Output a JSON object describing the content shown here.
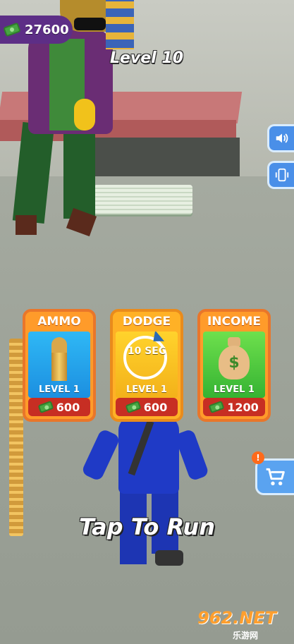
{
  "hud": {
    "money": "27600",
    "level_title": "Level 10"
  },
  "side_buttons": {
    "sound_icon": "speaker-icon",
    "vibration_icon": "vibration-icon"
  },
  "upgrades": [
    {
      "title": "AMMO",
      "level": "LEVEL 1",
      "price": "600",
      "icon": "bullet-icon",
      "color": "#2fb8f5"
    },
    {
      "title": "DODGE",
      "level": "LEVEL 1",
      "price": "600",
      "icon": "clock-icon",
      "timer_text": "10 SEC",
      "color": "#ffd32c"
    },
    {
      "title": "INCOME",
      "level": "LEVEL 1",
      "price": "1200",
      "icon": "money-bag-icon",
      "bag_symbol": "$",
      "color": "#6ee04d"
    }
  ],
  "shop": {
    "alert": "!",
    "icon": "shopping-cart-icon"
  },
  "prompt": "Tap To Run",
  "watermark": {
    "main": "962.NET",
    "sub": "乐游网"
  },
  "colors": {
    "card_border": "#e9762a",
    "price_bg": "#c72e23",
    "money_badge": "#5d2e86",
    "side_button": "#4a8fe8"
  }
}
